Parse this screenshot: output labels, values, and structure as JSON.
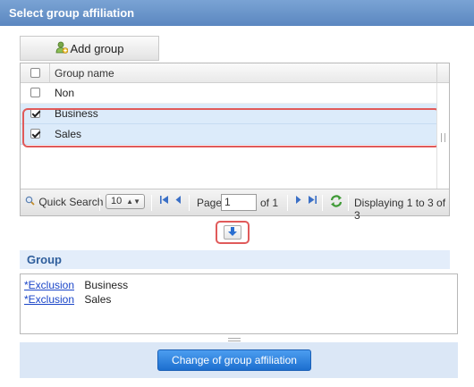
{
  "title": "Select group affiliation",
  "toolbar": {
    "add_group_label": "Add group",
    "add_group_icon": "add-user-icon"
  },
  "grid": {
    "column_header": "Group name",
    "rows": [
      {
        "name": "Non",
        "checked": false
      },
      {
        "name": "Business",
        "checked": true
      },
      {
        "name": "Sales",
        "checked": true
      }
    ],
    "highlight_color": "#e05a5a",
    "selected_row_color": "#dcebfa"
  },
  "pager": {
    "quick_search_label": "Quick Search",
    "per_page": "10",
    "page_label": "Page",
    "page_value": "1",
    "of_label": "of 1",
    "displaying": "Displaying 1 to 3 of 3"
  },
  "move_down_icon": "arrow-down-icon",
  "group": {
    "header": "Group",
    "items": [
      {
        "link": "*Exclusion",
        "name": "Business"
      },
      {
        "link": "*Exclusion",
        "name": "Sales"
      }
    ]
  },
  "footer": {
    "change_button_label": "Change of group affiliation",
    "button_color": "#1c6fcf"
  }
}
